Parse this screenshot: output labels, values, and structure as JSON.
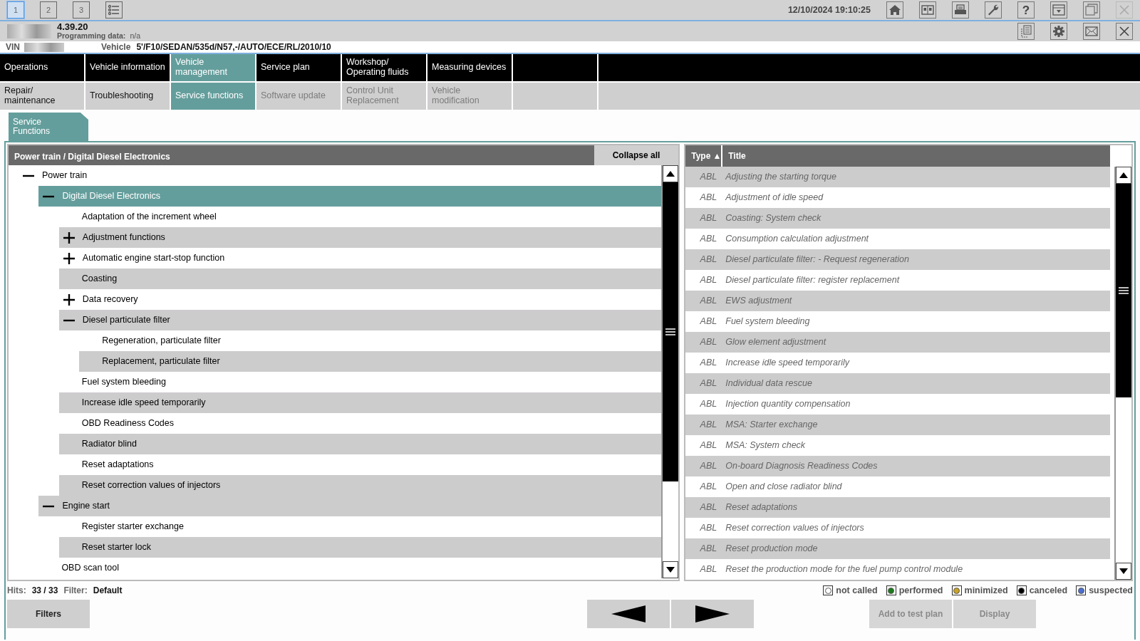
{
  "toolbar": {
    "tabs": [
      {
        "label": "1",
        "selected": true
      },
      {
        "label": "2",
        "selected": false
      },
      {
        "label": "3",
        "selected": false
      }
    ],
    "datetime": "12/10/2024 19:10:25",
    "help_label": "?"
  },
  "header": {
    "version": "4.39.20",
    "programming_label": "Programming data:",
    "programming_value": "n/a",
    "vin_label": "VIN",
    "vehicle_label": "Vehicle",
    "vehicle_value": "5'/F10/SEDAN/535d/N57,-/AUTO/ECE/RL/2010/10"
  },
  "main_nav": [
    {
      "label": "Operations",
      "selected": false
    },
    {
      "label": "Vehicle information",
      "selected": false
    },
    {
      "label": "Vehicle\nmanagement",
      "selected": true
    },
    {
      "label": "Service plan",
      "selected": false
    },
    {
      "label": "Workshop/\nOperating fluids",
      "selected": false
    },
    {
      "label": "Measuring devices",
      "selected": false
    }
  ],
  "sub_nav": [
    {
      "label": "Repair/\nmaintenance",
      "selected": false,
      "disabled": false
    },
    {
      "label": "Troubleshooting",
      "selected": false,
      "disabled": false
    },
    {
      "label": "Service functions",
      "selected": true,
      "disabled": false
    },
    {
      "label": "Software update",
      "selected": false,
      "disabled": true
    },
    {
      "label": "Control Unit\nReplacement",
      "selected": false,
      "disabled": true
    },
    {
      "label": "Vehicle modification",
      "selected": false,
      "disabled": true
    }
  ],
  "section_tab": "Service\nFunctions",
  "tree": {
    "path": "Power train / Digital Diesel Electronics",
    "collapse_all": "Collapse all",
    "items": [
      {
        "label": "Power train",
        "expanded": true,
        "selected": false,
        "children": [
          {
            "label": "Digital Diesel Electronics",
            "expanded": true,
            "selected": true,
            "children": [
              {
                "label": "Adaptation of the increment wheel",
                "selected": false
              },
              {
                "label": "Adjustment functions",
                "expanded": false,
                "selected": false
              },
              {
                "label": "Automatic engine start-stop function",
                "expanded": false,
                "selected": false
              },
              {
                "label": "Coasting",
                "selected": false
              },
              {
                "label": "Data recovery",
                "expanded": false,
                "selected": false
              },
              {
                "label": "Diesel particulate filter",
                "expanded": true,
                "selected": false,
                "children": [
                  {
                    "label": "Regeneration, particulate filter",
                    "selected": false
                  },
                  {
                    "label": "Replacement, particulate filter",
                    "selected": false
                  }
                ]
              },
              {
                "label": "Fuel system bleeding",
                "selected": false
              },
              {
                "label": "Increase idle speed temporarily",
                "selected": false
              },
              {
                "label": "OBD Readiness Codes",
                "selected": false
              },
              {
                "label": "Radiator blind",
                "selected": false
              },
              {
                "label": "Reset adaptations",
                "selected": false
              },
              {
                "label": "Reset correction values of injectors",
                "selected": false
              }
            ]
          },
          {
            "label": "Engine start",
            "expanded": true,
            "selected": false,
            "children": [
              {
                "label": "Register starter exchange",
                "selected": false
              },
              {
                "label": "Reset starter lock",
                "selected": false
              }
            ]
          },
          {
            "label": "OBD scan tool",
            "selected": false
          }
        ]
      }
    ]
  },
  "table": {
    "columns": [
      {
        "label": "Type",
        "sort_mark": "▲"
      },
      {
        "label": "Title"
      }
    ],
    "rows": [
      {
        "type": "ABL",
        "title": "Adjusting the starting torque"
      },
      {
        "type": "ABL",
        "title": "Adjustment of idle speed"
      },
      {
        "type": "ABL",
        "title": "Coasting: System check"
      },
      {
        "type": "ABL",
        "title": "Consumption calculation adjustment"
      },
      {
        "type": "ABL",
        "title": "Diesel particulate filter: - Request regeneration"
      },
      {
        "type": "ABL",
        "title": "Diesel particulate filter: register replacement"
      },
      {
        "type": "ABL",
        "title": "EWS adjustment"
      },
      {
        "type": "ABL",
        "title": "Fuel system bleeding"
      },
      {
        "type": "ABL",
        "title": "Glow element adjustment"
      },
      {
        "type": "ABL",
        "title": "Increase idle speed temporarily"
      },
      {
        "type": "ABL",
        "title": "Individual data rescue"
      },
      {
        "type": "ABL",
        "title": "Injection quantity compensation"
      },
      {
        "type": "ABL",
        "title": "MSA: Starter exchange"
      },
      {
        "type": "ABL",
        "title": "MSA: System check"
      },
      {
        "type": "ABL",
        "title": "On-board Diagnosis Readiness Codes"
      },
      {
        "type": "ABL",
        "title": "Open and close radiator blind"
      },
      {
        "type": "ABL",
        "title": "Reset adaptations"
      },
      {
        "type": "ABL",
        "title": "Reset correction values of injectors"
      },
      {
        "type": "ABL",
        "title": "Reset production mode"
      },
      {
        "type": "ABL",
        "title": "Reset the production mode for the fuel pump control module"
      }
    ]
  },
  "status": {
    "hits_label": "Hits:",
    "hits": "33 / 33",
    "filter_label": "Filter:",
    "filter": "Default"
  },
  "legend": [
    {
      "label": "not called",
      "color": "#ffffff"
    },
    {
      "label": "performed",
      "color": "#1a7a1a"
    },
    {
      "label": "minimized",
      "color": "#c9a227"
    },
    {
      "label": "canceled",
      "color": "#000000"
    },
    {
      "label": "suspected",
      "color": "#4a6fd0"
    }
  ],
  "buttons": [
    {
      "kind": "text",
      "label": "Filters",
      "disabled": false
    },
    {
      "kind": "prev"
    },
    {
      "kind": "next"
    },
    {
      "kind": "text",
      "label": "Add to test plan",
      "disabled": true
    },
    {
      "kind": "text",
      "label": "Display",
      "disabled": true
    }
  ]
}
